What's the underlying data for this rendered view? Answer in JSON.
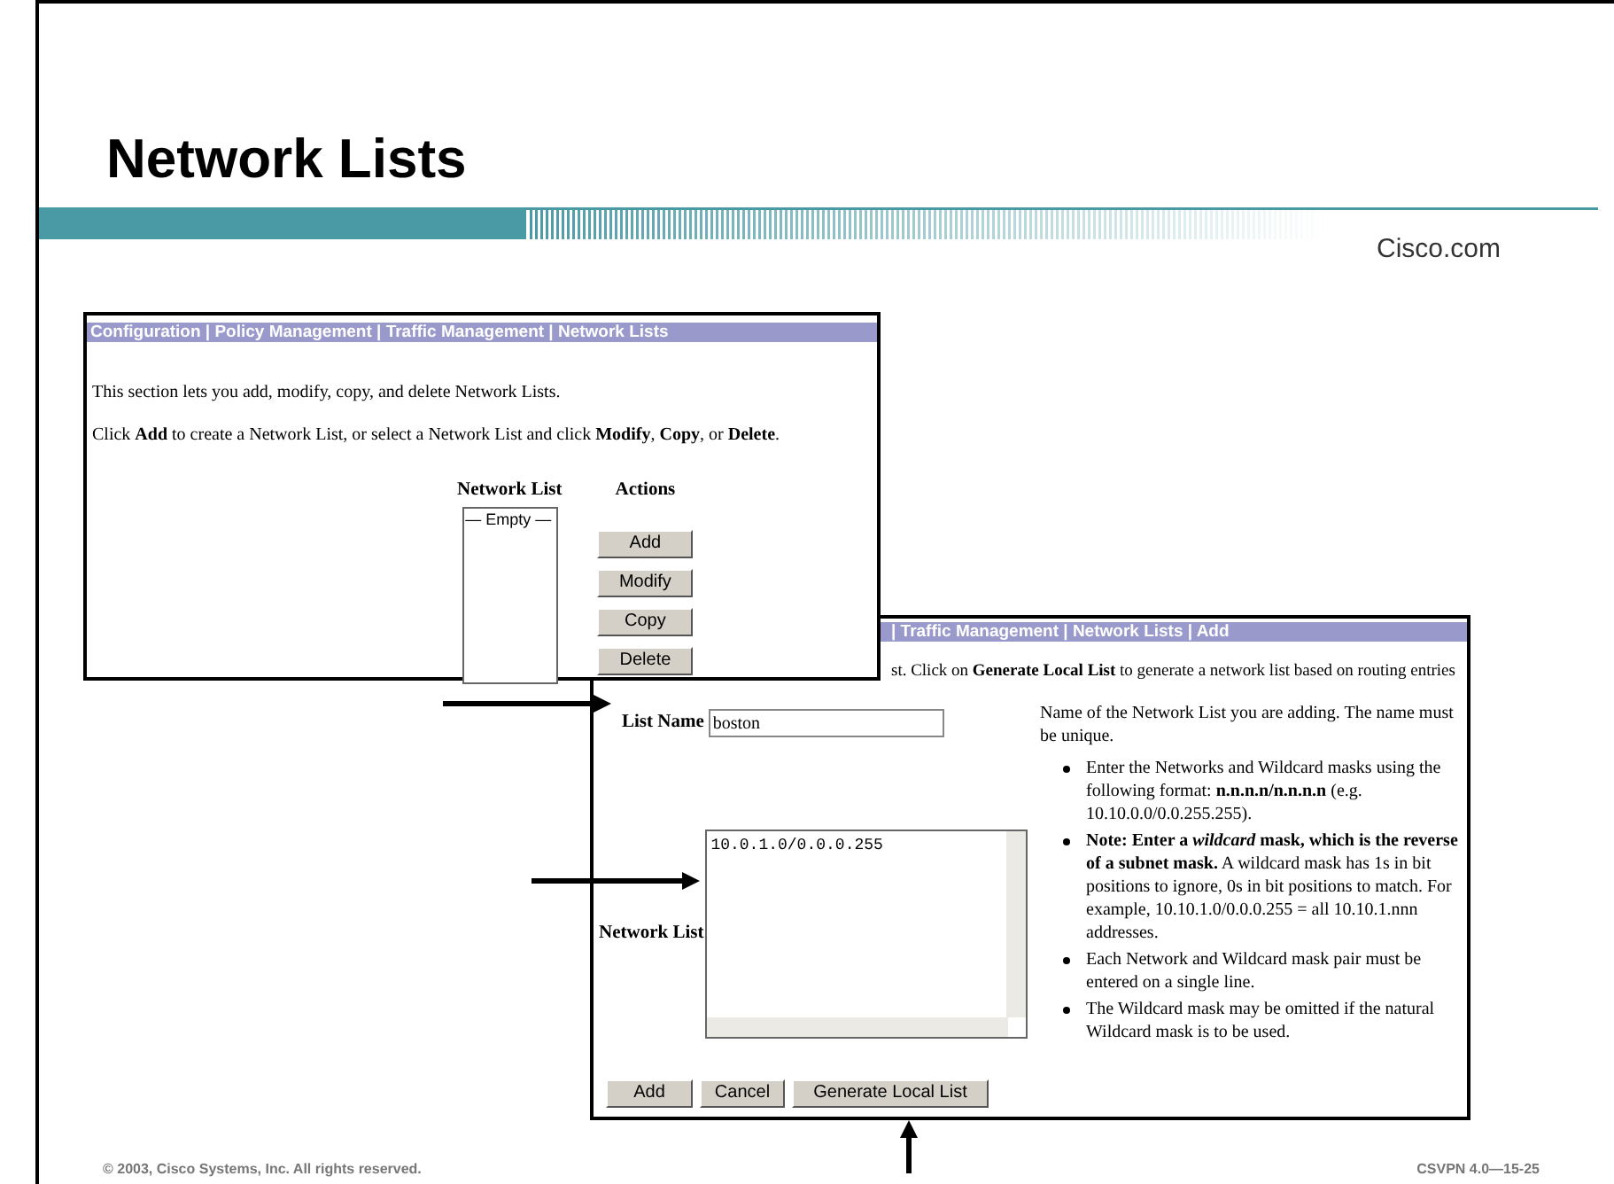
{
  "slide": {
    "title": "Network Lists",
    "brand": "Cisco.com"
  },
  "list_window": {
    "breadcrumb": "Configuration | Policy Management | Traffic Management | Network Lists",
    "paragraphs": [
      "This section lets you add, modify, copy, and delete Network Lists.",
      "Click **Add** to create a Network List, or select a Network List and click **Modify**, **Copy**, or **Delete**."
    ],
    "list_heading": "Network List",
    "actions_heading": "Actions",
    "list_items": [
      {
        "label": "— Empty —",
        "selected": false
      }
    ],
    "buttons": [
      "Add",
      "Modify",
      "Copy",
      "Delete"
    ]
  },
  "add_window": {
    "breadcrumb": "| Traffic Management | Network Lists | Add",
    "intro": "st. Click on **Generate Local List** to generate a network list based on routing entries",
    "list_name": {
      "label": "List Name",
      "value": "boston"
    },
    "network_list": {
      "label": "Network List",
      "value": "10.0.1.0/0.0.0.255"
    },
    "name_help": "Name of the Network List you are adding. The name must be unique.",
    "bullets": [
      "Enter the Networks and Wildcard masks using the following format: **n.n.n.n/n.n.n.n** (e.g. 10.10.0.0/0.0.255.255).",
      "**Note: Enter a *wildcard* mask, which is the reverse of a subnet mask.** A wildcard mask has 1s in bit positions to ignore, 0s in bit positions to match. For example, 10.10.1.0/0.0.0.255 = all 10.10.1.nnn addresses.",
      "Each Network and Wildcard mask pair must be entered on a single line.",
      "The Wildcard mask may be omitted if the natural Wildcard mask is to be used."
    ],
    "buttons": [
      "Add",
      "Cancel",
      "Generate Local List"
    ]
  },
  "footer": {
    "copyright": "© 2003, Cisco Systems, Inc. All rights reserved.",
    "course_code": "CSVPN 4.0—15-25"
  }
}
